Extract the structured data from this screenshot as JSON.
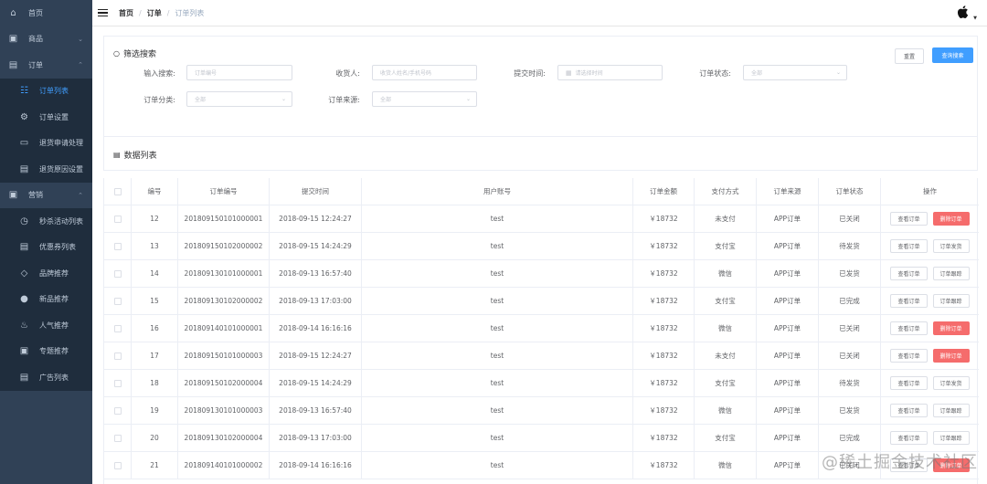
{
  "sidebar": {
    "items": [
      {
        "label": "首页",
        "icon": "home-icon",
        "glyph": "⌂",
        "arrow": ""
      },
      {
        "label": "商品",
        "icon": "product-icon",
        "glyph": "▣",
        "arrow": "⌄"
      },
      {
        "label": "订单",
        "icon": "order-icon",
        "glyph": "▤",
        "arrow": "⌃"
      }
    ],
    "order_sub": [
      {
        "label": "订单列表",
        "icon": "list-icon",
        "glyph": "☷",
        "active": true
      },
      {
        "label": "订单设置",
        "icon": "gear-icon",
        "glyph": "⚙"
      },
      {
        "label": "退货申请处理",
        "icon": "return-icon",
        "glyph": "▭"
      },
      {
        "label": "退货原因设置",
        "icon": "reason-icon",
        "glyph": "▤"
      }
    ],
    "marketing": {
      "label": "营销",
      "icon": "marketing-icon",
      "glyph": "▣",
      "arrow": "⌃"
    },
    "marketing_sub": [
      {
        "label": "秒杀活动列表",
        "icon": "clock-icon",
        "glyph": "◷"
      },
      {
        "label": "优惠券列表",
        "icon": "coupon-icon",
        "glyph": "▤"
      },
      {
        "label": "品牌推荐",
        "icon": "tag-icon",
        "glyph": "◇"
      },
      {
        "label": "新品推荐",
        "icon": "new-icon",
        "glyph": "●"
      },
      {
        "label": "人气推荐",
        "icon": "fire-icon",
        "glyph": "♨"
      },
      {
        "label": "专题推荐",
        "icon": "topic-icon",
        "glyph": "▣"
      },
      {
        "label": "广告列表",
        "icon": "ad-icon",
        "glyph": "▤"
      }
    ]
  },
  "breadcrumb": [
    "首页",
    "订单",
    "订单列表"
  ],
  "filter": {
    "title": "筛选搜索",
    "reset_label": "重置",
    "search_label": "查询搜索",
    "fields": {
      "keyword": {
        "label": "输入搜索:",
        "placeholder": "订单编号"
      },
      "receiver": {
        "label": "收货人:",
        "placeholder": "收货人姓名/手机号码"
      },
      "time": {
        "label": "提交时间:",
        "placeholder": "请选择时间"
      },
      "status": {
        "label": "订单状态:",
        "placeholder": "全部"
      },
      "type": {
        "label": "订单分类:",
        "placeholder": "全部"
      },
      "source": {
        "label": "订单来源:",
        "placeholder": "全部"
      }
    }
  },
  "data_title": "数据列表",
  "table": {
    "headers": [
      "编号",
      "订单编号",
      "提交时间",
      "用户账号",
      "订单金额",
      "支付方式",
      "订单来源",
      "订单状态",
      "操作"
    ],
    "rows": [
      {
        "id": "12",
        "sn": "201809150101000001",
        "time": "2018-09-15 12:24:27",
        "user": "test",
        "amount": "￥18732",
        "pay": "未支付",
        "source": "APP订单",
        "status": "已关闭",
        "a1": "查看订单",
        "a2": "删除订单",
        "a2_type": "danger"
      },
      {
        "id": "13",
        "sn": "201809150102000002",
        "time": "2018-09-15 14:24:29",
        "user": "test",
        "amount": "￥18732",
        "pay": "支付宝",
        "source": "APP订单",
        "status": "待发货",
        "a1": "查看订单",
        "a2": "订单发货",
        "a2_type": "default"
      },
      {
        "id": "14",
        "sn": "201809130101000001",
        "time": "2018-09-13 16:57:40",
        "user": "test",
        "amount": "￥18732",
        "pay": "微信",
        "source": "APP订单",
        "status": "已发货",
        "a1": "查看订单",
        "a2": "订单跟踪",
        "a2_type": "default"
      },
      {
        "id": "15",
        "sn": "201809130102000002",
        "time": "2018-09-13 17:03:00",
        "user": "test",
        "amount": "￥18732",
        "pay": "支付宝",
        "source": "APP订单",
        "status": "已完成",
        "a1": "查看订单",
        "a2": "订单跟踪",
        "a2_type": "default"
      },
      {
        "id": "16",
        "sn": "201809140101000001",
        "time": "2018-09-14 16:16:16",
        "user": "test",
        "amount": "￥18732",
        "pay": "微信",
        "source": "APP订单",
        "status": "已关闭",
        "a1": "查看订单",
        "a2": "删除订单",
        "a2_type": "danger"
      },
      {
        "id": "17",
        "sn": "201809150101000003",
        "time": "2018-09-15 12:24:27",
        "user": "test",
        "amount": "￥18732",
        "pay": "未支付",
        "source": "APP订单",
        "status": "已关闭",
        "a1": "查看订单",
        "a2": "删除订单",
        "a2_type": "danger"
      },
      {
        "id": "18",
        "sn": "201809150102000004",
        "time": "2018-09-15 14:24:29",
        "user": "test",
        "amount": "￥18732",
        "pay": "支付宝",
        "source": "APP订单",
        "status": "待发货",
        "a1": "查看订单",
        "a2": "订单发货",
        "a2_type": "default"
      },
      {
        "id": "19",
        "sn": "201809130101000003",
        "time": "2018-09-13 16:57:40",
        "user": "test",
        "amount": "￥18732",
        "pay": "微信",
        "source": "APP订单",
        "status": "已发货",
        "a1": "查看订单",
        "a2": "订单跟踪",
        "a2_type": "default"
      },
      {
        "id": "20",
        "sn": "201809130102000004",
        "time": "2018-09-13 17:03:00",
        "user": "test",
        "amount": "￥18732",
        "pay": "支付宝",
        "source": "APP订单",
        "status": "已完成",
        "a1": "查看订单",
        "a2": "订单跟踪",
        "a2_type": "default"
      },
      {
        "id": "21",
        "sn": "201809140101000002",
        "time": "2018-09-14 16:16:16",
        "user": "test",
        "amount": "￥18732",
        "pay": "微信",
        "source": "APP订单",
        "status": "已关闭",
        "a1": "查看订单",
        "a2": "删除订单",
        "a2_type": "danger"
      }
    ]
  },
  "watermark": "@稀土掘金技术社区",
  "colors": {
    "sidebar_bg": "#304156",
    "sidebar_sub_bg": "#1f2d3d",
    "active": "#409eff",
    "danger": "#f56c6c",
    "primary": "#409eff"
  }
}
